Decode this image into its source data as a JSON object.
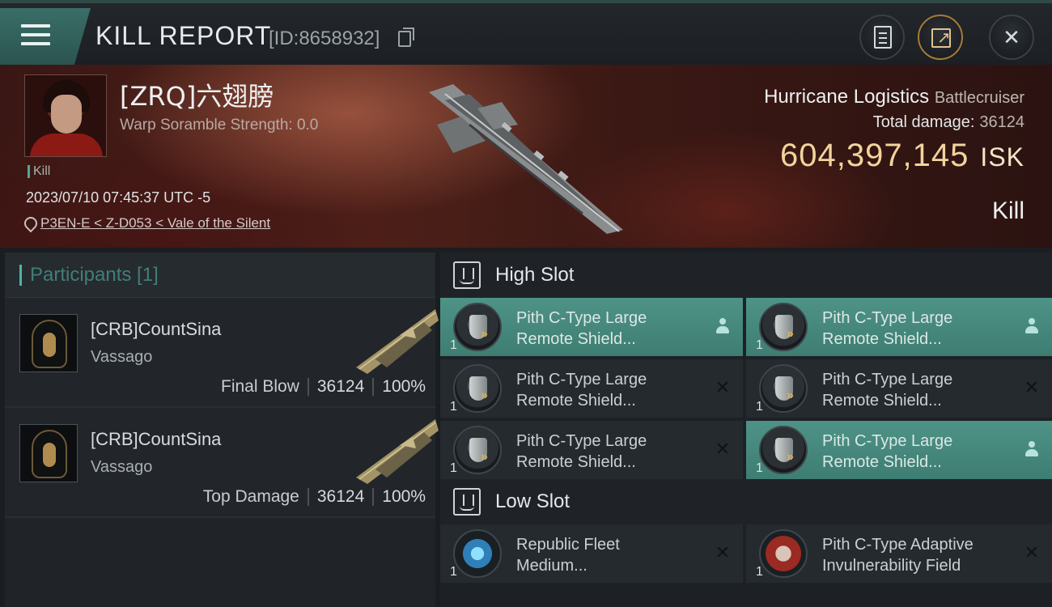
{
  "header": {
    "title": "KILL REPORT",
    "report_id": "[ID:8658932]"
  },
  "victim": {
    "name": "[ZRQ]六翅膀",
    "scramble": "Warp Soramble Strength: 0.0",
    "tag": "Kill",
    "time": "2023/07/10 07:45:37 UTC -5",
    "location": "P3EN-E < Z-D053 < Vale of the Silent"
  },
  "ship": {
    "name": "Hurricane Logistics",
    "class": "Battlecruiser",
    "total_damage_label": "Total damage:",
    "total_damage": "36124",
    "isk_value": "604,397,145",
    "isk_unit": "ISK",
    "result": "Kill"
  },
  "participants": {
    "header": "Participants [1]",
    "rows": [
      {
        "name": "[CRB]CountSina",
        "ship": "Vassago",
        "label": "Final Blow",
        "damage": "36124",
        "percent": "100%"
      },
      {
        "name": "[CRB]CountSina",
        "ship": "Vassago",
        "label": "Top Damage",
        "damage": "36124",
        "percent": "100%"
      }
    ]
  },
  "high_slot": {
    "title": "High Slot",
    "modules": [
      {
        "line1": "Pith C-Type Large",
        "line2": "Remote Shield...",
        "qty": "1",
        "state": "active",
        "icon": "shield-booster-icon"
      },
      {
        "line1": "Pith C-Type Large",
        "line2": "Remote Shield...",
        "qty": "1",
        "state": "active",
        "icon": "shield-booster-icon"
      },
      {
        "line1": "Pith C-Type Large",
        "line2": "Remote Shield...",
        "qty": "1",
        "state": "destroyed",
        "icon": "shield-booster-icon"
      },
      {
        "line1": "Pith C-Type Large",
        "line2": "Remote Shield...",
        "qty": "1",
        "state": "destroyed",
        "icon": "shield-booster-icon"
      },
      {
        "line1": "Pith C-Type Large",
        "line2": "Remote Shield...",
        "qty": "1",
        "state": "destroyed",
        "icon": "shield-booster-icon"
      },
      {
        "line1": "Pith C-Type Large",
        "line2": "Remote Shield...",
        "qty": "1",
        "state": "active",
        "icon": "shield-booster-icon"
      }
    ]
  },
  "low_slot": {
    "title": "Low Slot",
    "modules": [
      {
        "line1": "Republic Fleet",
        "line2": "Medium...",
        "qty": "1",
        "state": "destroyed",
        "icon": "afterburner-icon"
      },
      {
        "line1": "Pith C-Type Adaptive",
        "line2": "Invulnerability Field",
        "qty": "1",
        "state": "destroyed",
        "icon": "invulnerability-field-icon"
      }
    ]
  },
  "colors": {
    "accent_teal": "#4e9387",
    "isk_gold": "#f2d49c"
  }
}
